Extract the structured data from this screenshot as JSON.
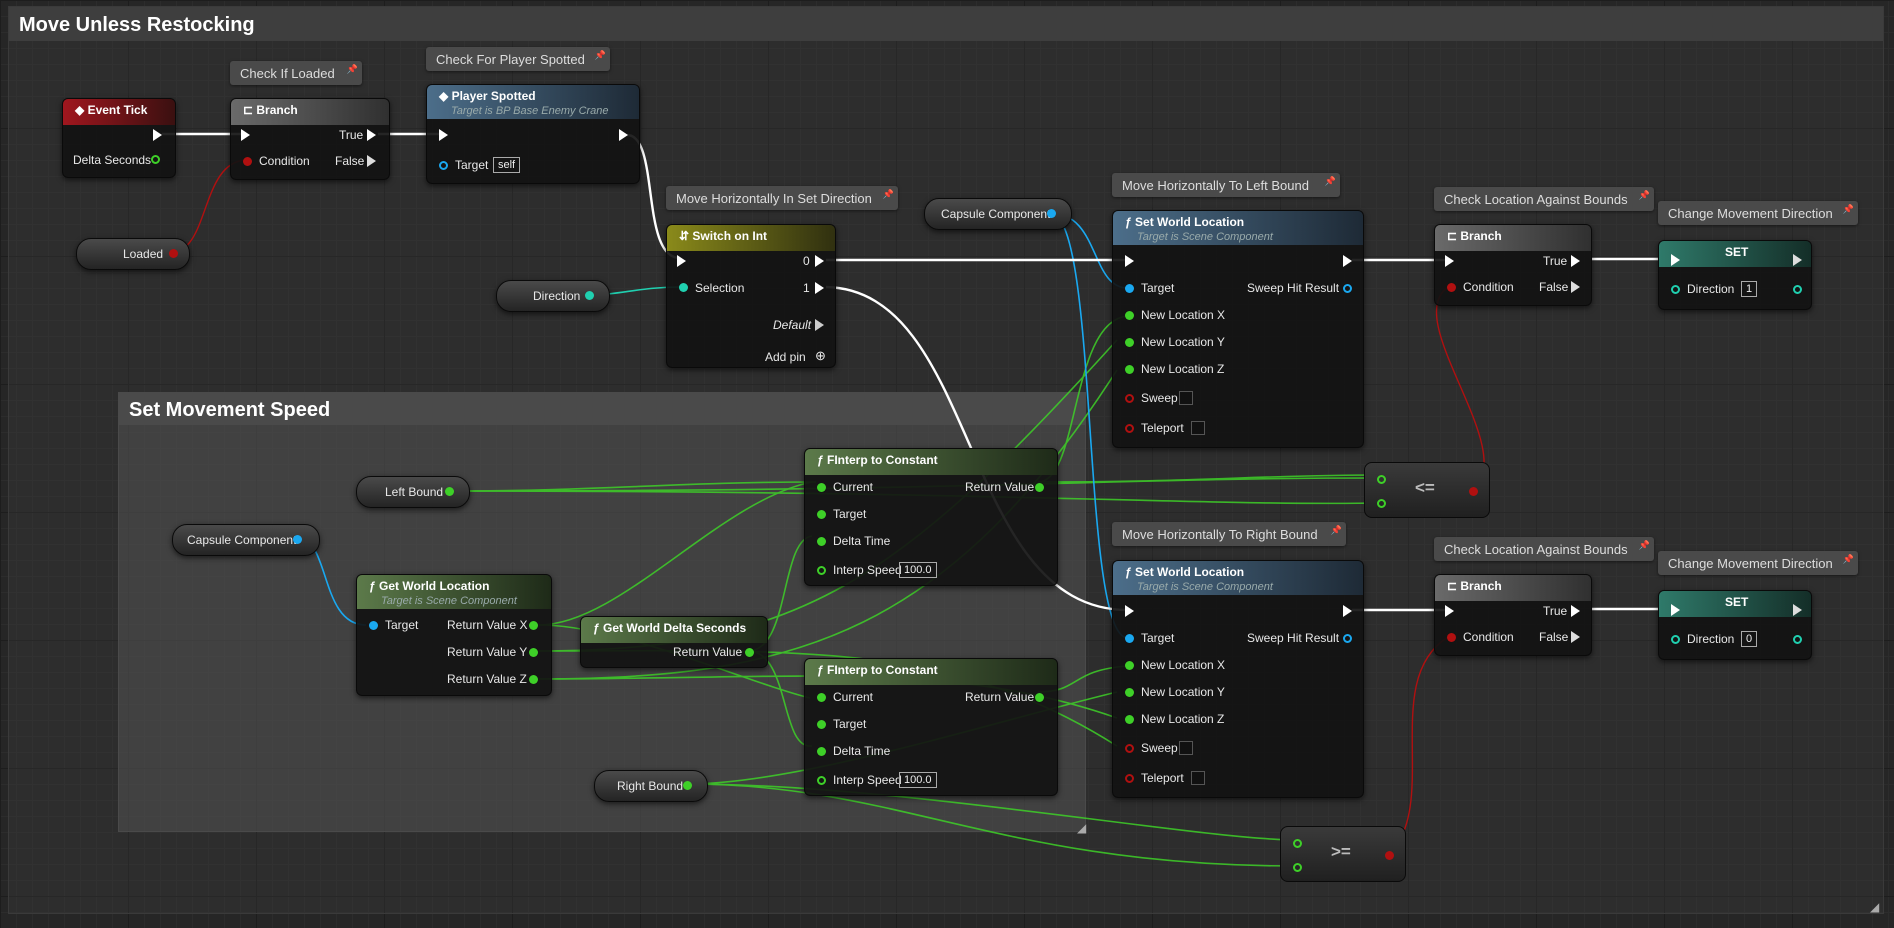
{
  "frame_title": "Move Unless Restocking",
  "group_title": "Set Movement Speed",
  "comments": {
    "check_if_loaded": "Check If Loaded",
    "check_player_spotted": "Check For Player Spotted",
    "move_set_direction": "Move Horizontally In Set Direction",
    "move_left": "Move Horizontally To Left Bound",
    "move_right": "Move Horizontally To Right Bound",
    "check_bounds": "Check Location Against Bounds",
    "change_direction": "Change Movement Direction"
  },
  "event_tick": {
    "title": "Event Tick",
    "delta": "Delta Seconds"
  },
  "branch": {
    "title": "Branch",
    "true": "True",
    "false": "False",
    "condition": "Condition"
  },
  "player_spotted": {
    "title": "Player Spotted",
    "subtitle": "Target is BP Base Enemy Crane",
    "target": "Target",
    "target_value": "self"
  },
  "loaded_var": "Loaded",
  "direction_var": "Direction",
  "switch": {
    "title": "Switch on Int",
    "selection": "Selection",
    "pin0": "0",
    "pin1": "1",
    "default": "Default",
    "add_pin": "Add pin"
  },
  "capsule_component": "Capsule Component",
  "set_world_location": {
    "title": "Set World Location",
    "subtitle": "Target is Scene Component",
    "target": "Target",
    "sweep_hit": "Sweep Hit Result",
    "x": "New Location X",
    "y": "New Location Y",
    "z": "New Location Z",
    "sweep": "Sweep",
    "teleport": "Teleport"
  },
  "set_node": {
    "title": "SET",
    "direction": "Direction",
    "value_left": "1",
    "value_right": "0"
  },
  "left_bound": "Left Bound",
  "right_bound": "Right Bound",
  "get_world_location": {
    "title": "Get World Location",
    "subtitle": "Target is Scene Component",
    "target": "Target",
    "rx": "Return Value X",
    "ry": "Return Value Y",
    "rz": "Return Value Z"
  },
  "get_delta": {
    "title": "Get World Delta Seconds",
    "rv": "Return Value"
  },
  "finterp": {
    "title": "FInterp to Constant",
    "current": "Current",
    "target": "Target",
    "delta": "Delta Time",
    "interp": "Interp Speed",
    "interp_value": "100.0",
    "rv": "Return Value"
  },
  "ops": {
    "le": "<=",
    "ge": ">="
  },
  "colors": {
    "exec": "#ffffff",
    "float": "#3ed028",
    "object": "#1aa8f0",
    "bool": "#b01010",
    "int": "#20d0b0"
  }
}
